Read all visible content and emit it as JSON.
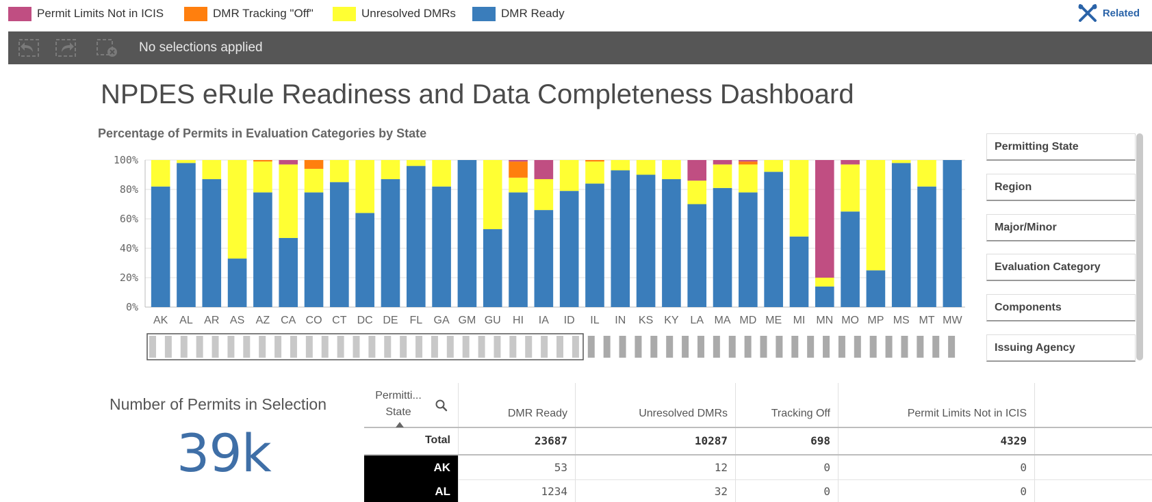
{
  "legend": [
    {
      "label": "Permit Limits Not in ICIS",
      "color": "#c04e82"
    },
    {
      "label": "DMR Tracking \"Off\"",
      "color": "#ff7f0e"
    },
    {
      "label": "Unresolved DMRs",
      "color": "#ffff33"
    },
    {
      "label": "DMR Ready",
      "color": "#3a7dbb"
    }
  ],
  "header": {
    "related_label": "Related"
  },
  "toolbar": {
    "selection_text": "No selections applied"
  },
  "dashboard_title": "NPDES eRule Readiness and Data Completeness Dashboard",
  "chart_data": {
    "type": "bar",
    "stacked": true,
    "title": "Percentage of Permits in Evaluation Categories by State",
    "categories": [
      "AK",
      "AL",
      "AR",
      "AS",
      "AZ",
      "CA",
      "CO",
      "CT",
      "DC",
      "DE",
      "FL",
      "GA",
      "GM",
      "GU",
      "HI",
      "IA",
      "ID",
      "IL",
      "IN",
      "KS",
      "KY",
      "LA",
      "MA",
      "MD",
      "ME",
      "MI",
      "MN",
      "MO",
      "MP",
      "MS",
      "MT",
      "MW"
    ],
    "y_ticks": [
      "0%",
      "20%",
      "40%",
      "60%",
      "80%",
      "100%"
    ],
    "ylim": [
      0,
      100
    ],
    "series": [
      {
        "name": "DMR Ready",
        "color": "#3a7dbb",
        "values": [
          82,
          98,
          87,
          33,
          78,
          47,
          78,
          85,
          64,
          87,
          96,
          82,
          100,
          53,
          78,
          66,
          79,
          84,
          93,
          90,
          87,
          70,
          81,
          78,
          92,
          48,
          14,
          65,
          25,
          98,
          82,
          100
        ]
      },
      {
        "name": "Unresolved DMRs",
        "color": "#ffff33",
        "values": [
          18,
          2,
          13,
          67,
          21,
          50,
          16,
          15,
          36,
          13,
          4,
          18,
          0,
          47,
          10,
          21,
          21,
          15,
          7,
          10,
          13,
          16,
          16,
          19,
          8,
          52,
          6,
          32,
          75,
          2,
          18,
          0
        ]
      },
      {
        "name": "DMR Tracking \"Off\"",
        "color": "#ff7f0e",
        "values": [
          0,
          0,
          0,
          0,
          1,
          0,
          6,
          0,
          0,
          0,
          0,
          0,
          0,
          0,
          11,
          0,
          0,
          1,
          0,
          0,
          0,
          0,
          0,
          2,
          0,
          0,
          0,
          0,
          0,
          0,
          0,
          0
        ]
      },
      {
        "name": "Permit Limits Not in ICIS",
        "color": "#c04e82",
        "values": [
          0,
          0,
          0,
          0,
          0,
          3,
          0,
          0,
          0,
          0,
          0,
          0,
          0,
          0,
          1,
          13,
          0,
          0,
          0,
          0,
          0,
          14,
          3,
          1,
          0,
          0,
          80,
          3,
          0,
          0,
          0,
          0
        ]
      }
    ],
    "grid": true,
    "legend_position": "top"
  },
  "filters": [
    "Permitting State",
    "Region",
    "Major/Minor",
    "Evaluation Category",
    "Components",
    "Issuing Agency"
  ],
  "kpi": {
    "label": "Number of Permits in Selection",
    "value": "39k"
  },
  "table": {
    "headers": {
      "state_line1": "Permitti...",
      "state_line2": "State",
      "dmr_ready": "DMR Ready",
      "unresolved": "Unresolved DMRs",
      "tracking_off": "Tracking Off",
      "limits": "Permit Limits Not in ICIS"
    },
    "total": {
      "label": "Total",
      "dmr_ready": "23687",
      "unresolved": "10287",
      "tracking_off": "698",
      "limits": "4329"
    },
    "rows": [
      {
        "state": "AK",
        "dmr_ready": "53",
        "unresolved": "12",
        "tracking_off": "0",
        "limits": "0"
      },
      {
        "state": "AL",
        "dmr_ready": "1234",
        "unresolved": "32",
        "tracking_off": "0",
        "limits": "0"
      }
    ]
  }
}
